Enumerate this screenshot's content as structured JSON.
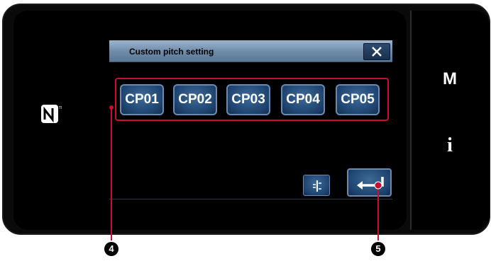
{
  "dialog": {
    "title": "Custom pitch setting",
    "cp_buttons": [
      "CP01",
      "CP02",
      "CP03",
      "CP04",
      "CP05"
    ]
  },
  "side_panel": {
    "m_label": "M",
    "info_label": "i"
  },
  "callouts": {
    "cp_group_number": "4",
    "enter_number": "5"
  },
  "icons": {
    "nfc": "nfc-n-mark-icon",
    "close": "close-x-icon",
    "pitch": "pitch-adjust-icon",
    "enter": "enter-return-icon"
  },
  "colors": {
    "titlebar": "#7c98b8",
    "button": "#1f4470",
    "button_border": "#6a8ab0",
    "callout_line": "#c8102e"
  }
}
